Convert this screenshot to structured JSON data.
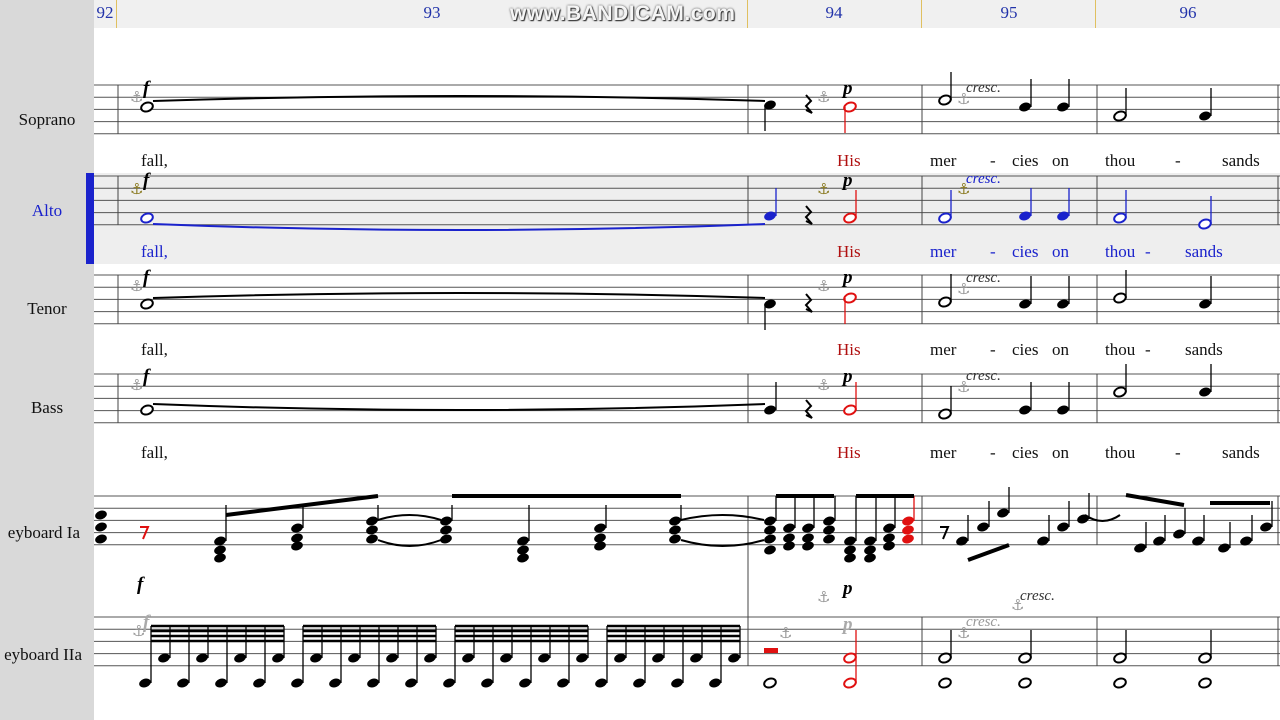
{
  "watermark": "www.BANDICAM.com",
  "measures": [
    "92",
    "93",
    "94",
    "95",
    "96"
  ],
  "staves": [
    {
      "label": "Soprano"
    },
    {
      "label": "Alto"
    },
    {
      "label": "Tenor"
    },
    {
      "label": "Bass"
    },
    {
      "label": "eyboard Ia"
    },
    {
      "label": "eyboard IIa"
    }
  ],
  "lyrics": {
    "soprano": [
      "fall,",
      "His",
      "mer",
      "-",
      "cies",
      "on",
      "thou",
      "-",
      "sands"
    ],
    "alto": [
      "fall,",
      "His",
      "mer",
      "-",
      "cies",
      "on",
      "thou",
      "-",
      "sands"
    ],
    "tenor": [
      "fall,",
      "His",
      "mer",
      "-",
      "cies",
      "on",
      "thou",
      "-",
      "sands"
    ],
    "bass": [
      "fall,",
      "His",
      "mer",
      "-",
      "cies",
      "on",
      "thou",
      "-",
      "sands"
    ]
  },
  "dynamics": {
    "forte": "f",
    "piano": "p",
    "crescendo": "cresc."
  },
  "colors": {
    "selection": "#1a22cc",
    "selected_note": "#e01010",
    "lyric_selected": "#b01010",
    "ruler_number": "#2233aa"
  },
  "icons": {
    "anchor": "⚓"
  }
}
